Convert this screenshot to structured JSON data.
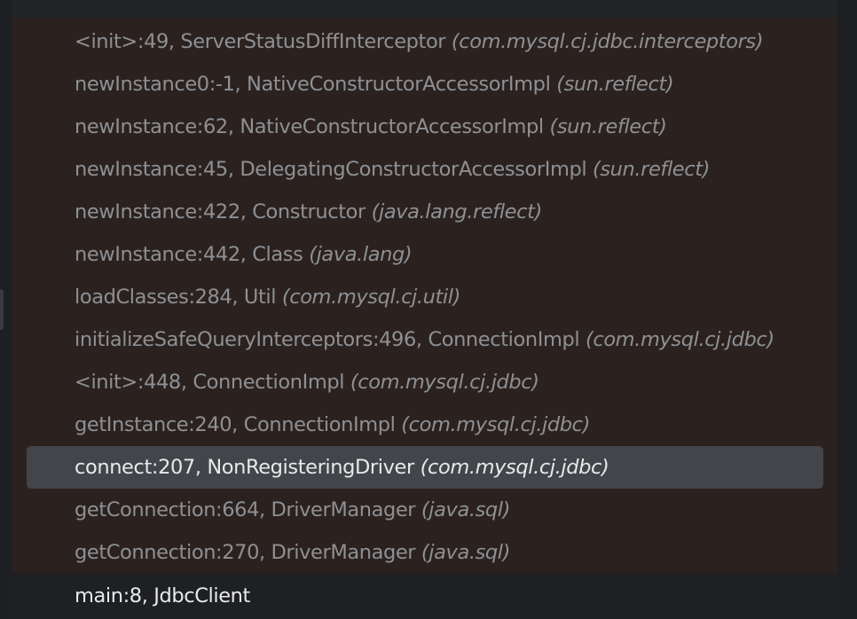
{
  "frames": [
    {
      "method": "<init>:49, ServerStatusDiffInterceptor",
      "package": "(com.mysql.cj.jdbc.interceptors)"
    },
    {
      "method": "newInstance0:-1, NativeConstructorAccessorImpl",
      "package": "(sun.reflect)"
    },
    {
      "method": "newInstance:62, NativeConstructorAccessorImpl",
      "package": "(sun.reflect)"
    },
    {
      "method": "newInstance:45, DelegatingConstructorAccessorImpl",
      "package": "(sun.reflect)"
    },
    {
      "method": "newInstance:422, Constructor",
      "package": "(java.lang.reflect)"
    },
    {
      "method": "newInstance:442, Class",
      "package": "(java.lang)"
    },
    {
      "method": "loadClasses:284, Util",
      "package": "(com.mysql.cj.util)"
    },
    {
      "method": "initializeSafeQueryInterceptors:496, ConnectionImpl",
      "package": "(com.mysql.cj.jdbc)"
    },
    {
      "method": "<init>:448, ConnectionImpl",
      "package": "(com.mysql.cj.jdbc)"
    },
    {
      "method": "getInstance:240, ConnectionImpl",
      "package": "(com.mysql.cj.jdbc)"
    },
    {
      "method": "connect:207, NonRegisteringDriver",
      "package": "(com.mysql.cj.jdbc)"
    },
    {
      "method": "getConnection:664, DriverManager",
      "package": "(java.sql)"
    },
    {
      "method": "getConnection:270, DriverManager",
      "package": "(java.sql)"
    }
  ],
  "selected_index": 10,
  "main_frame": {
    "method": "main:8, JdbcClient"
  },
  "colors": {
    "panel_bg": "#2b2220",
    "text_dim": "#8e9094",
    "text_bright": "#e8e9eb",
    "selection_bg": "#43454a"
  }
}
